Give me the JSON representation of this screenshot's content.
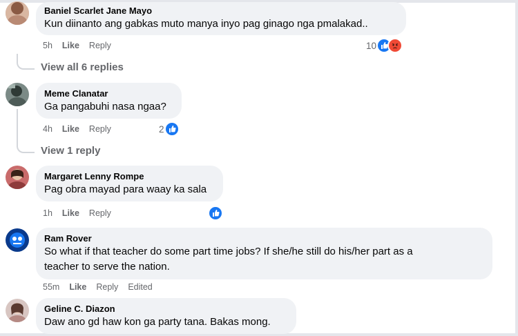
{
  "comments": [
    {
      "name": "Baniel Scarlet Jane Mayo",
      "text": "Kun diinanto ang gabkas muto manya inyo pag ginago nga pmalakad..",
      "time": "5h",
      "like": "Like",
      "reply": "Reply",
      "reaction_count": "10",
      "reactions": [
        "like-icon",
        "angry-icon"
      ]
    },
    {
      "name": "Meme Clanatar",
      "text": "Ga pangabuhi nasa ngaa?",
      "time": "4h",
      "like": "Like",
      "reply": "Reply",
      "reaction_count": "2",
      "reactions": [
        "like-icon"
      ]
    },
    {
      "name": "Margaret Lenny Rompe",
      "text": "Pag obra mayad para waay ka sala",
      "time": "1h",
      "like": "Like",
      "reply": "Reply",
      "reaction_count": "",
      "reactions": [
        "like-icon"
      ]
    },
    {
      "name": "Ram Rover",
      "text_lines": [
        "So what if that teacher do some part time jobs? If she/he still do his/her part as a",
        "teacher to serve the nation."
      ],
      "time": "55m",
      "like": "Like",
      "reply": "Reply",
      "edited": "Edited"
    },
    {
      "name": "Geline C. Diazon",
      "text": "Daw ano gd haw kon ga party tana. Bakas mong."
    }
  ],
  "view_replies": [
    "View all 6 replies",
    "View 1 reply"
  ],
  "colors": {
    "bubble": "#f0f2f5",
    "muted": "#65676b",
    "like_blue": "#1877f2",
    "angry_red": "#f04a36"
  }
}
